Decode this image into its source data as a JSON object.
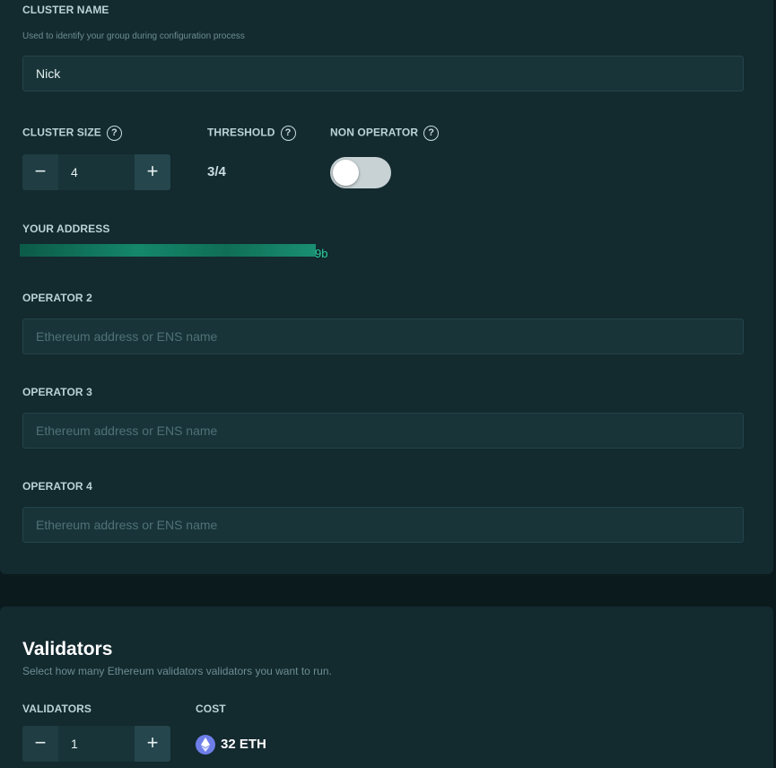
{
  "cluster": {
    "name_label": "CLUSTER NAME",
    "name_hint": "Used to identify your group during configuration process",
    "name_value": "Nick",
    "size_label": "CLUSTER SIZE",
    "size_value": "4",
    "threshold_label": "THRESHOLD",
    "threshold_value": "3/4",
    "non_operator_label": "NON OPERATOR",
    "non_operator_on": false,
    "help_glyph": "?"
  },
  "address": {
    "label": "YOUR ADDRESS",
    "tail": "9b"
  },
  "operators": [
    {
      "label": "OPERATOR 2",
      "placeholder": "Ethereum address or ENS name"
    },
    {
      "label": "OPERATOR 3",
      "placeholder": "Ethereum address or ENS name"
    },
    {
      "label": "OPERATOR 4",
      "placeholder": "Ethereum address or ENS name"
    }
  ],
  "validators": {
    "title": "Validators",
    "hint": "Select how many Ethereum validators validators you want to run.",
    "count_label": "VALIDATORS",
    "count_value": "1",
    "cost_label": "COST",
    "cost_value": "32 ETH"
  },
  "stepper": {
    "minus": "−",
    "plus": "+"
  },
  "icons": {
    "help": "help-circle-icon",
    "eth": "ethereum-icon"
  },
  "colors": {
    "accent": "#2ad49d",
    "panel": "#132a2f",
    "eth": "#6e7ee8"
  }
}
